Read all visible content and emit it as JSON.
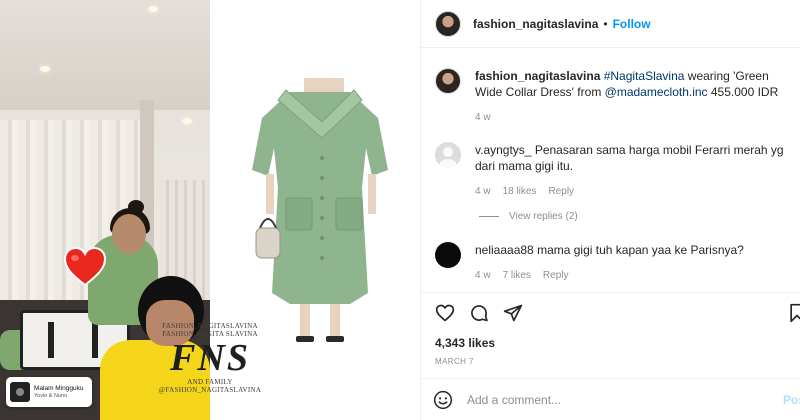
{
  "media": {
    "music": {
      "title": "Malam Mingguku",
      "artist": "Yovie & Nuno"
    },
    "watermark": {
      "line1": "FASHION_NAGITASLAVINA",
      "line2": "FASHION NAGITA SLAVINA",
      "logo": "FNS",
      "line3": "AND FAMILY",
      "line4": "@FASHION_NAGITASLAVINA"
    }
  },
  "header": {
    "username": "fashion_nagitaslavina",
    "separator": "•",
    "follow_label": "Follow"
  },
  "caption": {
    "username": "fashion_nagitaslavina",
    "hashtag": "#NagitaSlavina",
    "text_1": " wearing 'Green Wide Collar Dress' from ",
    "mention": "@madamecloth.inc",
    "text_2": " 455.000 IDR",
    "time": "4 w"
  },
  "comments": [
    {
      "username": "v.ayngtys_",
      "text": " Penasaran sama harga mobil Ferarri merah yg dari mama gigi itu.",
      "time": "4 w",
      "likes": "18 likes",
      "reply_label": "Reply",
      "view_replies": "View replies (2)"
    },
    {
      "username": "neliaaaa88",
      "text": " mama gigi tuh kapan yaa ke Parisnya?",
      "time": "4 w",
      "likes": "7 likes",
      "reply_label": "Reply"
    }
  ],
  "stats": {
    "likes": "4,343 likes",
    "date": "MARCH 7"
  },
  "add_comment": {
    "placeholder": "Add a comment...",
    "post_label": "Post"
  },
  "icons": {
    "like": "heart-icon",
    "comment": "comment-bubble-icon",
    "share": "paper-plane-icon",
    "save": "bookmark-icon",
    "emoji": "emoji-smiley-icon",
    "sticker": "heart-sticker-icon"
  },
  "colors": {
    "accent": "#0095f6",
    "link": "#00376b",
    "muted": "#8e8e8e",
    "heart": "#e8271d",
    "dress": "#8fb58f"
  }
}
